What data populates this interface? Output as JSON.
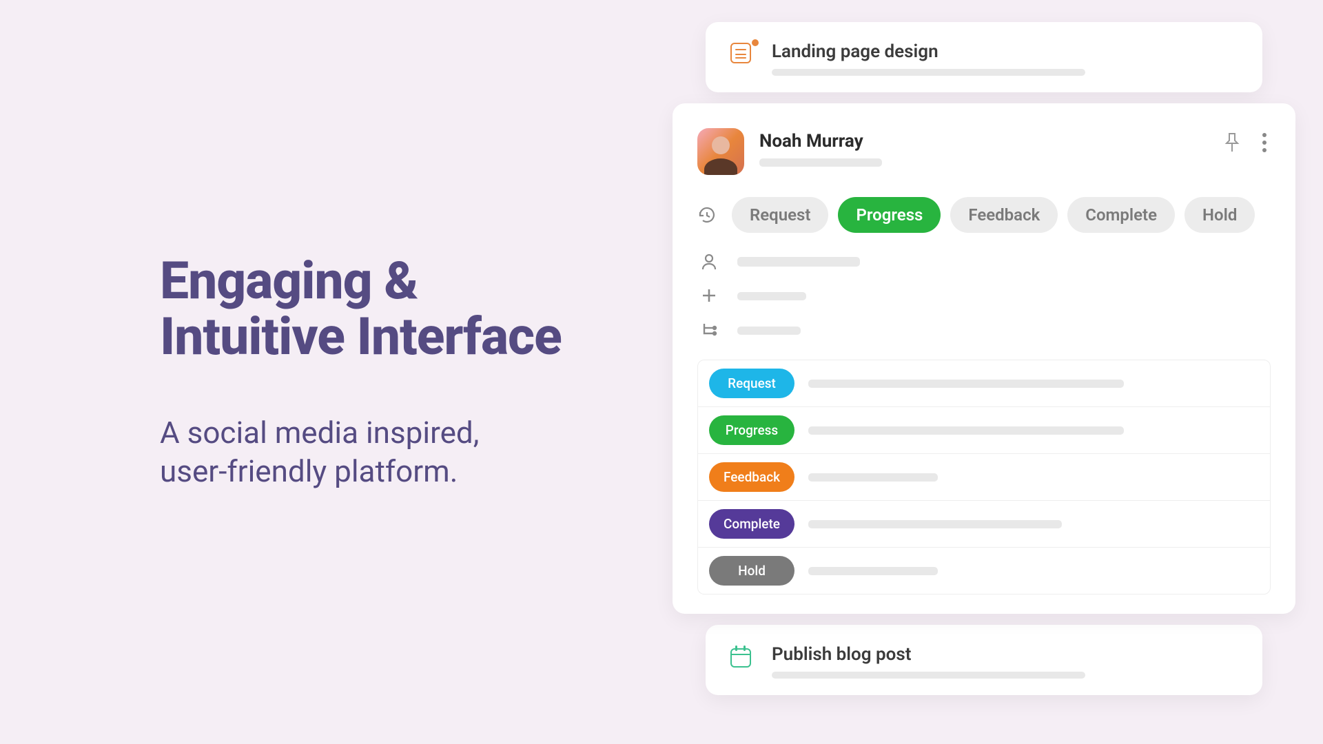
{
  "hero": {
    "heading_line1": "Engaging &",
    "heading_line2": "Intuitive Interface",
    "sub_line1": "A social media inspired,",
    "sub_line2": "user-friendly platform."
  },
  "top_card": {
    "title": "Landing page design"
  },
  "main": {
    "user_name": "Noah Murray",
    "statuses": [
      {
        "label": "Request",
        "active": false
      },
      {
        "label": "Progress",
        "active": true
      },
      {
        "label": "Feedback",
        "active": false
      },
      {
        "label": "Complete",
        "active": false
      },
      {
        "label": "Hold",
        "active": false
      }
    ],
    "tasks": [
      {
        "label": "Request",
        "class": "b-request",
        "bar": "pb-task-long"
      },
      {
        "label": "Progress",
        "class": "b-progress",
        "bar": "pb-task-long"
      },
      {
        "label": "Feedback",
        "class": "b-feedback",
        "bar": "pb-task-short"
      },
      {
        "label": "Complete",
        "class": "b-complete",
        "bar": "pb-task-med"
      },
      {
        "label": "Hold",
        "class": "b-hold",
        "bar": "pb-task-short"
      }
    ]
  },
  "bottom_card": {
    "title": "Publish blog post"
  }
}
